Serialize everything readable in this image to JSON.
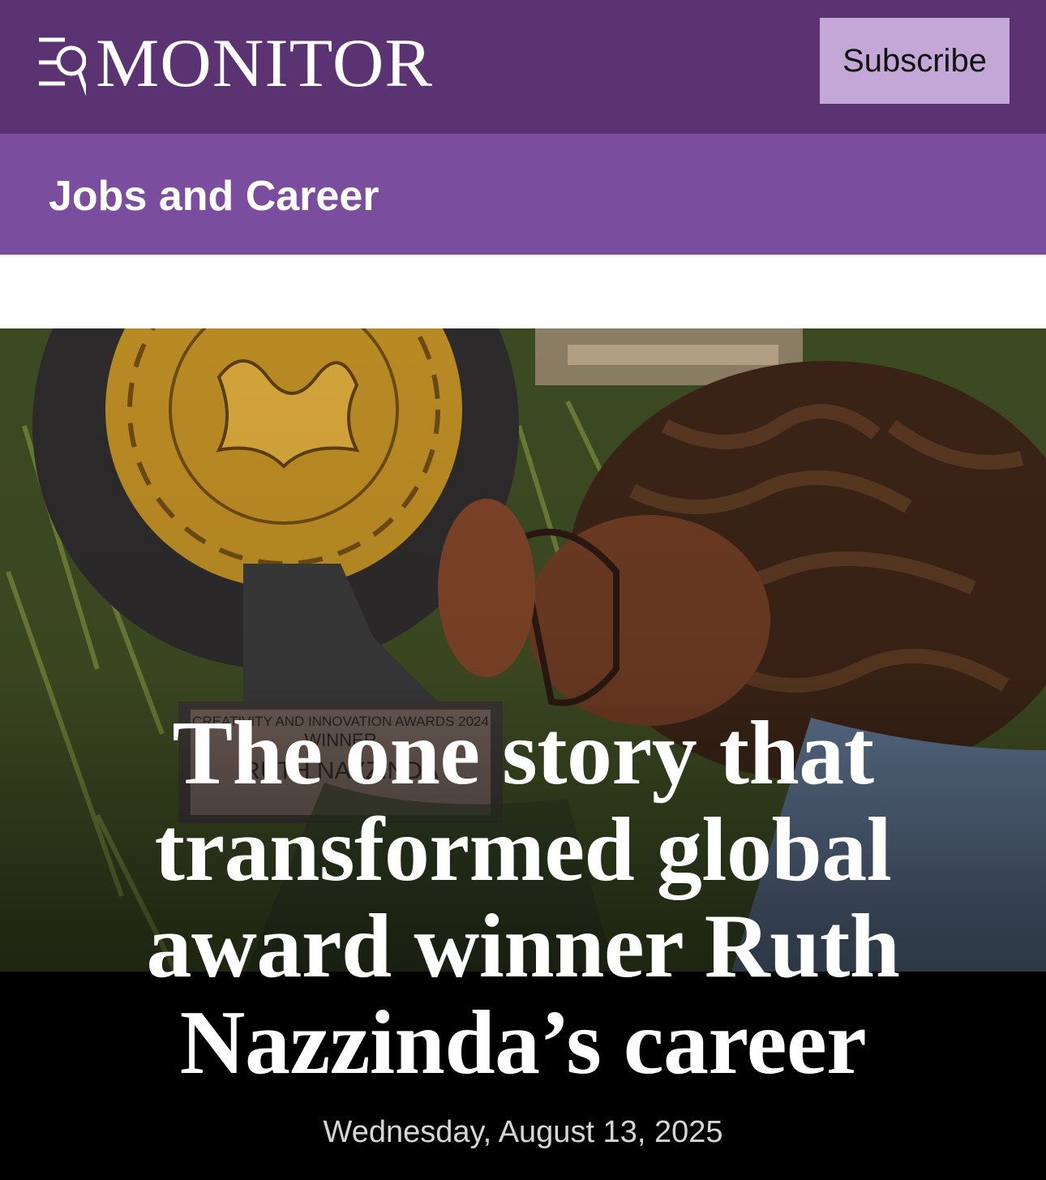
{
  "header": {
    "brand": "MONITOR",
    "menu_icon": "menu-search-icon",
    "subscribe_label": "Subscribe",
    "background_color": "#5b3272",
    "subscribe_color": "#c3a7d7"
  },
  "section": {
    "title": "Jobs and Career",
    "background_color": "#7a4d9e"
  },
  "article": {
    "headline": "The one story that transformed global award winner Ruth Nazzinda’s career",
    "date": "Wednesday, August 13, 2025",
    "image_caption_text": [
      "CREATIVITY AND INNOVATION AWARDS 2024",
      "WINNER",
      "RUTH NAZZINDA"
    ]
  }
}
